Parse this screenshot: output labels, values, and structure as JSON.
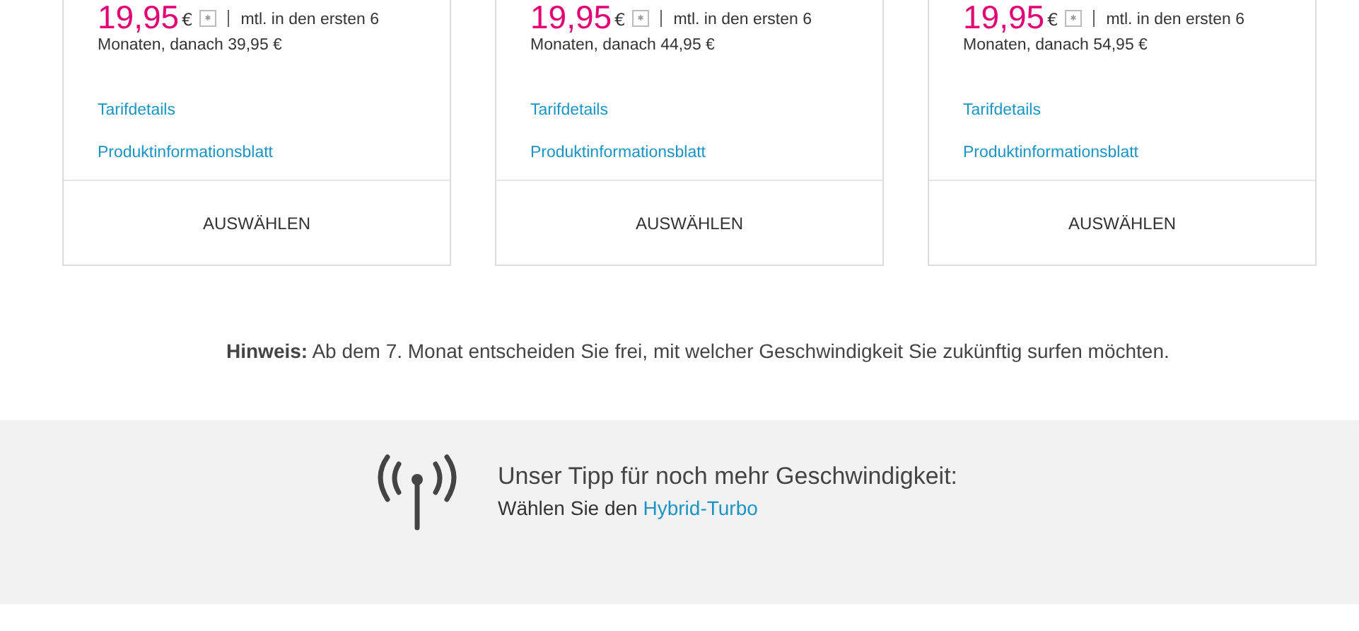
{
  "offers": [
    {
      "price": "19,95",
      "currency": "€",
      "price_note": "mtl. in den ersten 6",
      "price_note_2": "Monaten, danach 39,95 €",
      "links": [
        "Tarifdetails",
        "Produktinformationsblatt"
      ],
      "button": "AUSWÄHLEN"
    },
    {
      "price": "19,95",
      "currency": "€",
      "price_note": "mtl. in den ersten 6",
      "price_note_2": "Monaten, danach 44,95 €",
      "links": [
        "Tarifdetails",
        "Produktinformationsblatt"
      ],
      "button": "AUSWÄHLEN"
    },
    {
      "price": "19,95",
      "currency": "€",
      "price_note": "mtl. in den ersten 6",
      "price_note_2": "Monaten, danach 54,95 €",
      "links": [
        "Tarifdetails",
        "Produktinformationsblatt"
      ],
      "button": "AUSWÄHLEN"
    }
  ],
  "note": "**Hinweis:** Ab dem 7. Monat entscheiden Sie frei, mit welcher Geschwindigkeit Sie zukünftig surfen möchten.",
  "tip": {
    "title": "Unser Tipp für noch mehr Geschwindigkeit:",
    "text": "Wählen Sie den",
    "link": "Hybrid-Turbo"
  }
}
